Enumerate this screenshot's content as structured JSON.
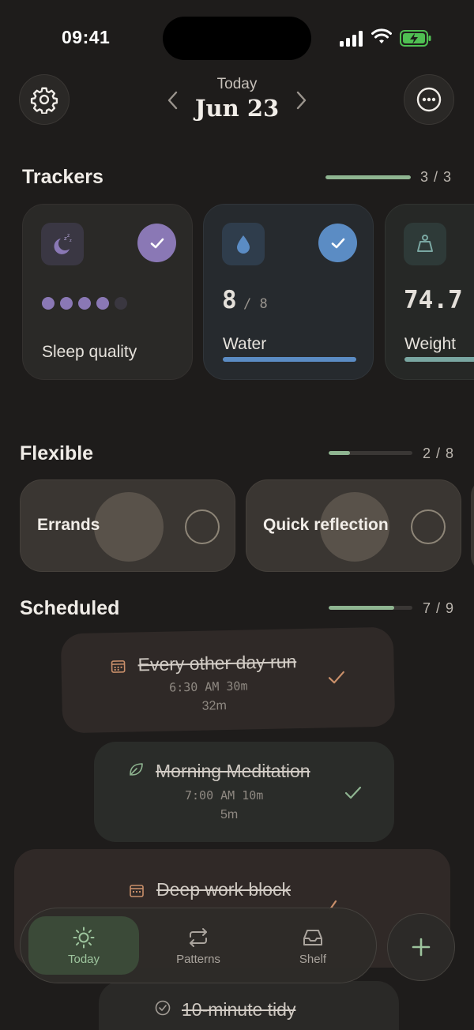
{
  "status": {
    "time": "09:41"
  },
  "header": {
    "date_label": "Today",
    "date_value": "Jun 23"
  },
  "trackers": {
    "title": "Trackers",
    "progress": "3 / 3",
    "progress_fraction": 1.0,
    "items": [
      {
        "label": "Sleep quality",
        "icon": "moon-zzz-icon",
        "done": true,
        "rating": 4,
        "rating_max": 5,
        "accent": "#8a78b5"
      },
      {
        "label": "Water",
        "icon": "water-drop-icon",
        "done": true,
        "value": "8",
        "goal": "/ 8",
        "accent": "#5b8cc4"
      },
      {
        "label": "Weight",
        "icon": "scale-icon",
        "value": "74.7",
        "accent": "#7aa7a2"
      }
    ]
  },
  "flexible": {
    "title": "Flexible",
    "progress": "2 / 8",
    "progress_fraction": 0.25,
    "items": [
      {
        "label": "Errands"
      },
      {
        "label": "Quick reflection"
      }
    ]
  },
  "scheduled": {
    "title": "Scheduled",
    "progress": "7 / 9",
    "progress_fraction": 0.78,
    "items": [
      {
        "title": "Every other day run",
        "time": "6:30 AM 30m",
        "duration": "32m",
        "icon": "calendar-icon",
        "done": true
      },
      {
        "title": "Morning Meditation",
        "time": "7:00 AM 10m",
        "duration": "5m",
        "icon": "leaf-icon",
        "done": true
      },
      {
        "title": "Deep work block",
        "icon": "calendar-icon",
        "done": true
      },
      {
        "title": "10-minute tidy",
        "icon": "check-circle-icon",
        "done": true
      }
    ]
  },
  "nav": {
    "tabs": [
      {
        "label": "Today",
        "icon": "sun-icon",
        "active": true
      },
      {
        "label": "Patterns",
        "icon": "repeat-icon",
        "active": false
      },
      {
        "label": "Shelf",
        "icon": "inbox-icon",
        "active": false
      }
    ],
    "add_icon": "plus-icon"
  },
  "colors": {
    "background": "#1e1c1b",
    "accent_green": "#8fb591",
    "sleep_purple": "#8a78b5",
    "water_blue": "#5b8cc4",
    "weight_teal": "#7aa7a2"
  }
}
